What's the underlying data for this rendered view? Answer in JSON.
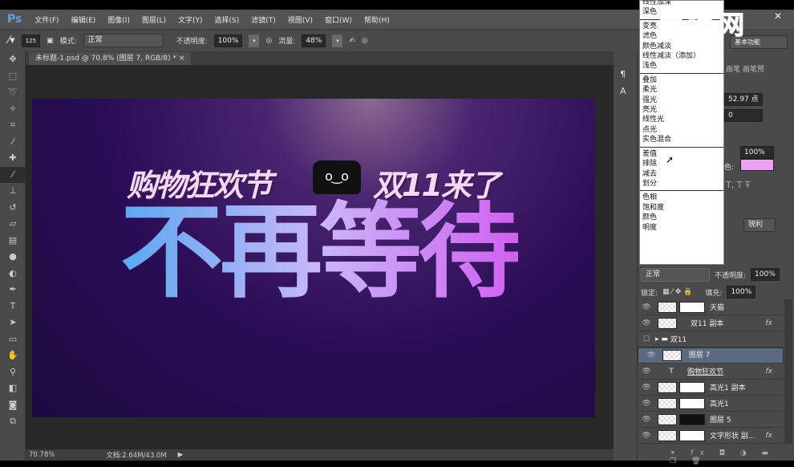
{
  "app": {
    "logo": "Ps"
  },
  "menu": [
    "文件(F)",
    "编辑(E)",
    "图像(I)",
    "图层(L)",
    "文字(Y)",
    "选择(S)",
    "滤镜(T)",
    "视图(V)",
    "窗口(W)",
    "帮助(H)"
  ],
  "options": {
    "brush_size": "125",
    "mode_label": "模式:",
    "mode_value": "正常",
    "opacity_label": "不透明度:",
    "opacity_value": "100%",
    "flow_label": "流量:",
    "flow_value": "48%"
  },
  "document_tab": {
    "title": "未标题-1.psd @ 70.8% (图层 7, RGB/8) *",
    "close": "×"
  },
  "canvas": {
    "subtitle_left": "购物狂欢节",
    "subtitle_right": "双11来了",
    "headline": "不再等待",
    "cat": "o ͜ o"
  },
  "status": {
    "zoom": "70.78%",
    "doc": "文档:2.64M/43.0M"
  },
  "watermark": "虎课网",
  "workspace": "基本功能",
  "blend_menu": {
    "groups": [
      [
        "线性加深",
        "深色"
      ],
      [
        "变亮",
        "滤色",
        "颜色减淡",
        "线性减淡（添加）",
        "浅色"
      ],
      [
        "叠加",
        "柔光",
        "强光",
        "亮光",
        "线性光",
        "点光",
        "实色混合"
      ],
      [
        "差值",
        "排除",
        "减去",
        "划分"
      ],
      [
        "色相",
        "饱和度",
        "颜色",
        "明度"
      ]
    ]
  },
  "char_panel": {
    "tabs": "画笔 画笔预",
    "leading": "52.97 点",
    "tracking": "0",
    "scale": "100%",
    "color_label": "色:",
    "color": "#f0a0f0",
    "aa": "锐利"
  },
  "layers_panel": {
    "blend": "正常",
    "opacity_label": "不透明度:",
    "opacity": "100%",
    "lock_label": "锁定:",
    "fill_label": "填充:",
    "fill": "100%",
    "layers": [
      {
        "name": "天猫",
        "mask": true
      },
      {
        "name": "双11 副本",
        "fx": "fx"
      },
      {
        "name": "双11",
        "group": true
      },
      {
        "name": "图层 7",
        "selected": true
      },
      {
        "name": "购物狂欢节",
        "text": true,
        "fx": "fx"
      },
      {
        "name": "高光1 副本",
        "mask": true
      },
      {
        "name": "高光1",
        "mask": true
      },
      {
        "name": "图层 5",
        "mask": true,
        "dark": true
      },
      {
        "name": "文字形状 副...",
        "mask": true,
        "fx": "fx"
      }
    ]
  }
}
